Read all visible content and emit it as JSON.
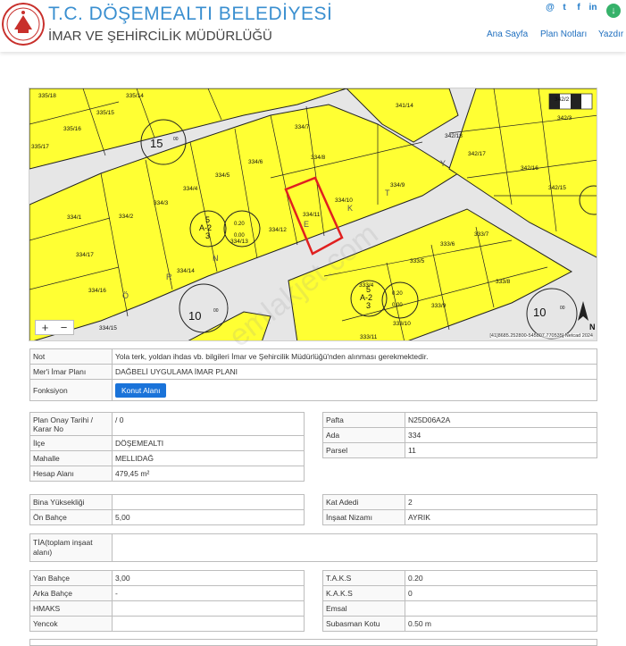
{
  "header": {
    "title": "T.C. DÖŞEMEALTI BELEDİYESİ",
    "subtitle": "İMAR VE ŞEHİRCİLİK MÜDÜRLÜĞÜ",
    "nav": [
      "Ana Sayfa",
      "Plan Notları",
      "Yazdır"
    ],
    "social": [
      "@",
      "t",
      "f",
      "in"
    ]
  },
  "map": {
    "parcels": [
      "335/18",
      "335/14",
      "335/15",
      "335/16",
      "335/17",
      "334/7",
      "334/6",
      "334/8",
      "334/5",
      "334/4",
      "334/9",
      "334/10",
      "334/3",
      "334/2",
      "334/1",
      "334/11",
      "334/12",
      "334/13",
      "334/17",
      "334/14",
      "334/16",
      "334/15",
      "341/14",
      "342/2",
      "342/3",
      "342/18",
      "342/17",
      "342/16",
      "342/15",
      "333/6",
      "333/7",
      "333/5",
      "333/8",
      "333/4",
      "333/9",
      "333/10",
      "333/11"
    ],
    "zone_labels": [
      "15",
      "10",
      "10"
    ],
    "zone_small": [
      "00",
      "00",
      "00"
    ],
    "taks_labels": [
      {
        "top": "5",
        "mid": "A-2",
        "bot": "3",
        "ratio1": "0.20",
        "ratio2": "0.00"
      },
      {
        "top": "5",
        "mid": "A-2",
        "bot": "3",
        "ratio1": "0.20",
        "ratio2": "0.00"
      }
    ],
    "road_letters": [
      "Ö",
      "R",
      "N",
      "E",
      "K",
      "T",
      "Y"
    ],
    "zoom_in": "+",
    "zoom_out": "−",
    "north": "N",
    "attribution": "[41]8685.252800-545807.770535] Netcad 2024"
  },
  "note_table": [
    {
      "label": "Not",
      "value": "Yola terk, yoldan ihdas vb. bilgileri İmar ve Şehircilik Müdürlüğü'nden alınması gerekmektedir."
    },
    {
      "label": "Mer'i İmar Planı",
      "value": "DAĞBELİ UYGULAMA İMAR PLANI"
    },
    {
      "label": "Fonksiyon",
      "button": "Konut Alanı"
    }
  ],
  "plan_table": [
    {
      "label": "Plan Onay Tarihi / Karar No",
      "value": "/ 0"
    },
    {
      "label": "İlçe",
      "value": "DÖŞEMEALTI"
    },
    {
      "label": "Mahalle",
      "value": "MELLIDAĞ"
    },
    {
      "label": "Hesap Alanı",
      "value": "479,45 m²"
    }
  ],
  "pafta_table": [
    {
      "label": "Pafta",
      "value": "N25D06A2A"
    },
    {
      "label": "Ada",
      "value": "334"
    },
    {
      "label": "Parsel",
      "value": "11"
    }
  ],
  "height_table": [
    {
      "label": "Bina Yüksekliği",
      "value": ""
    },
    {
      "label": "Ön Bahçe",
      "value": "5,00"
    }
  ],
  "floor_table": [
    {
      "label": "Kat Adedi",
      "value": "2"
    },
    {
      "label": "İnşaat Nizamı",
      "value": "AYRIK"
    }
  ],
  "tia_table": [
    {
      "label": "TİA(toplam inşaat alanı)",
      "value": ""
    }
  ],
  "garden_table": [
    {
      "label": "Yan Bahçe",
      "value": "3,00"
    },
    {
      "label": "Arka Bahçe",
      "value": "-"
    },
    {
      "label": "HMAKS",
      "value": ""
    },
    {
      "label": "Yencok",
      "value": ""
    }
  ],
  "ratio_table": [
    {
      "label": "T.A.K.S",
      "value": "0.20"
    },
    {
      "label": "K.A.K.S",
      "value": "0"
    },
    {
      "label": "Emsal",
      "value": ""
    },
    {
      "label": "Subasman Kotu",
      "value": "0.50 m"
    }
  ],
  "watermark": "emlakjet.com"
}
